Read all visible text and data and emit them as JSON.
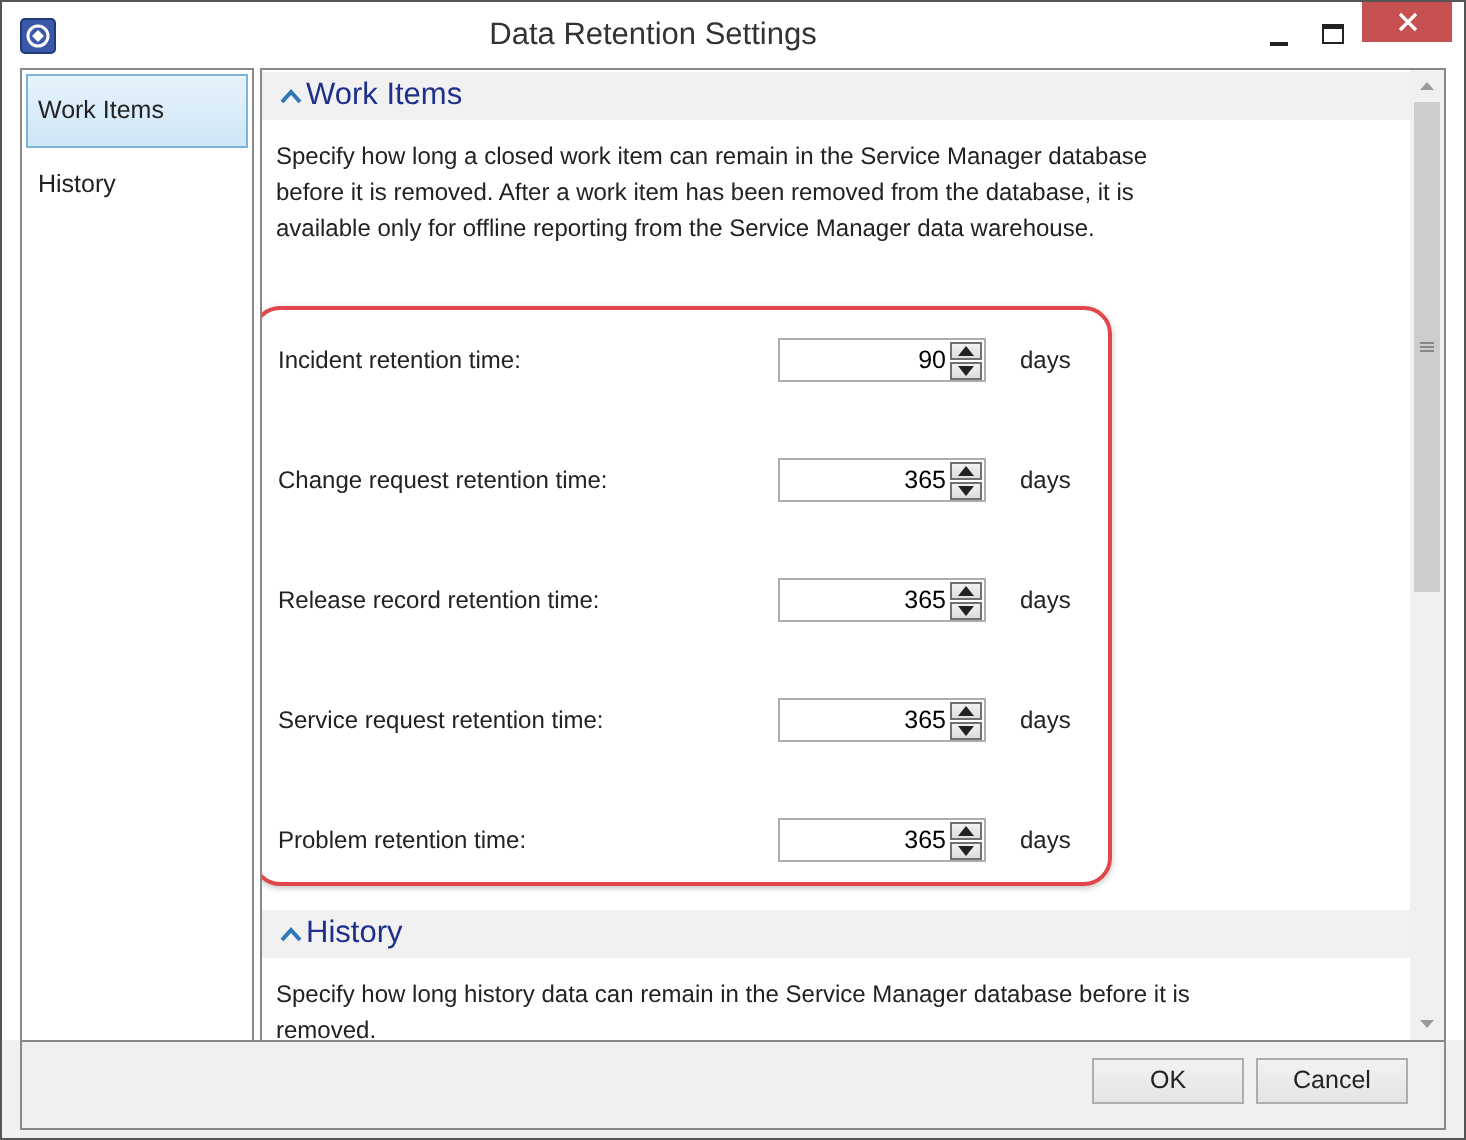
{
  "window": {
    "title": "Data Retention Settings"
  },
  "sidebar": {
    "items": [
      {
        "label": "Work Items",
        "selected": true
      },
      {
        "label": "History",
        "selected": false
      }
    ]
  },
  "sections": [
    {
      "title": "Work Items",
      "expanded": true,
      "description": "Specify how long a closed work item can remain in the Service Manager database before it is removed. After a work item has been removed from the database, it is available only for offline reporting from the Service Manager data warehouse.",
      "fields": [
        {
          "label": "Incident retention time:",
          "value": "90",
          "unit": "days"
        },
        {
          "label": "Change request retention time:",
          "value": "365",
          "unit": "days"
        },
        {
          "label": "Release record retention time:",
          "value": "365",
          "unit": "days"
        },
        {
          "label": "Service request retention time:",
          "value": "365",
          "unit": "days"
        },
        {
          "label": "Problem retention time:",
          "value": "365",
          "unit": "days"
        }
      ]
    },
    {
      "title": "History",
      "expanded": true,
      "description": "Specify how long history data can remain in the Service Manager database before it is removed."
    }
  ],
  "buttons": [
    {
      "label": "OK"
    },
    {
      "label": "Cancel"
    }
  ]
}
